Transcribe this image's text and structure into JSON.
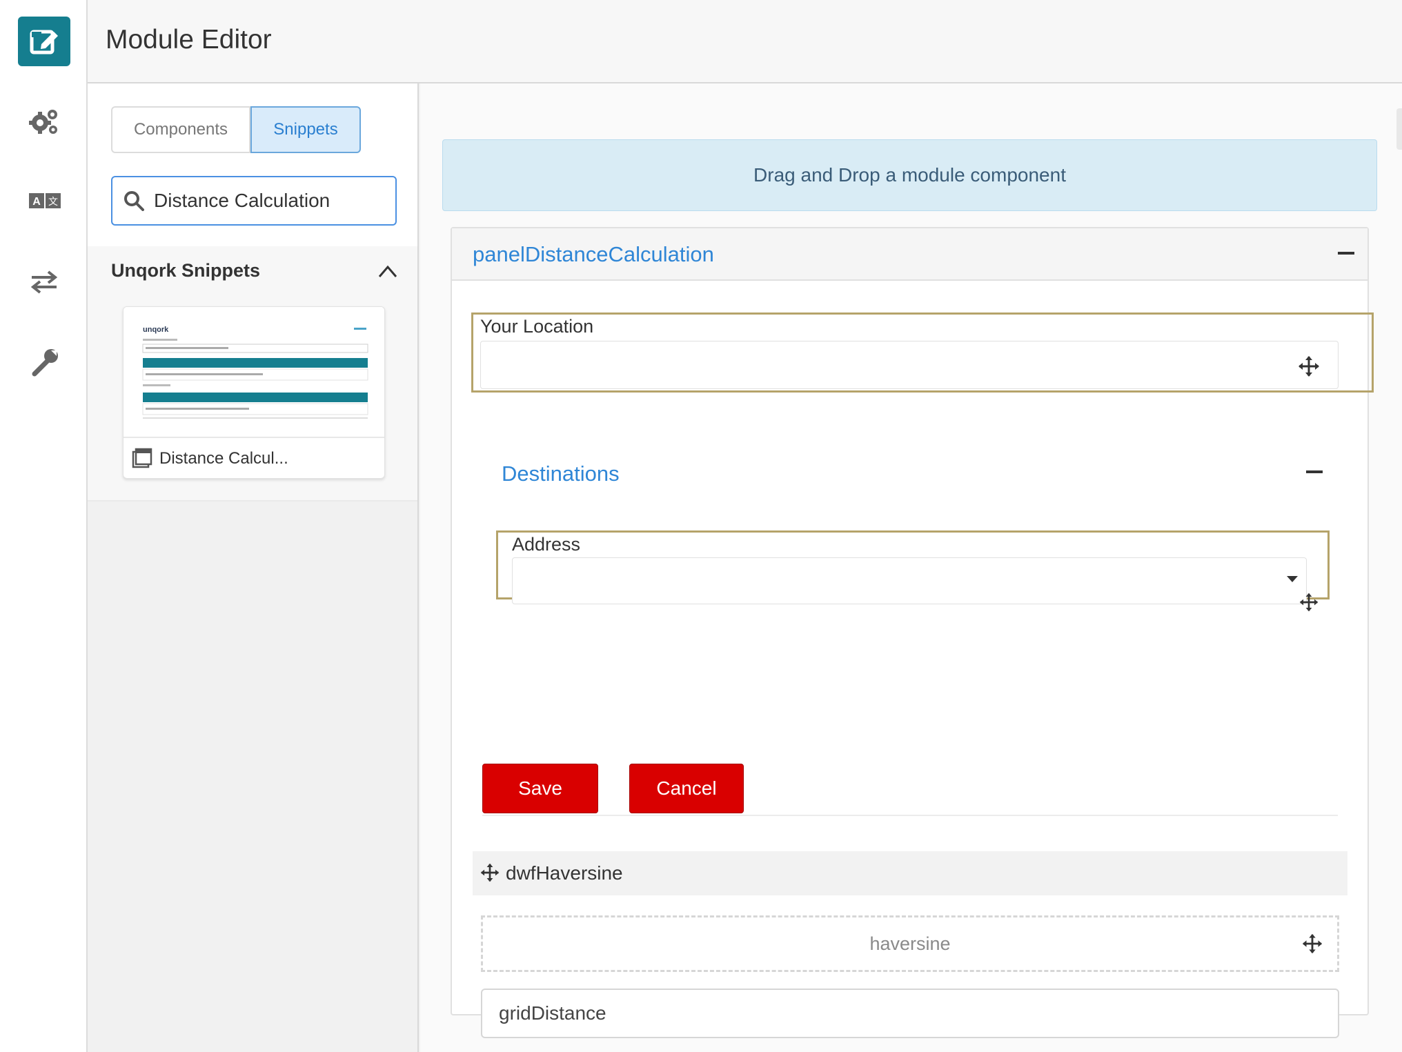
{
  "header": {
    "title": "Module Editor"
  },
  "rail": {
    "items": [
      {
        "name": "module-editor",
        "icon": "edit-icon",
        "active": true
      },
      {
        "name": "settings",
        "icon": "gears-icon"
      },
      {
        "name": "translation",
        "icon": "translate-icon"
      },
      {
        "name": "data-exchange",
        "icon": "arrows-exchange-icon"
      },
      {
        "name": "tools",
        "icon": "wrench-icon"
      }
    ],
    "accent": "#157e8f"
  },
  "leftpanel": {
    "tabs": [
      {
        "label": "Components",
        "active": false
      },
      {
        "label": "Snippets",
        "active": true
      }
    ],
    "search": {
      "value": "Distance Calculation",
      "icon": "search-icon"
    },
    "section": {
      "title": "Unqork Snippets",
      "icon": "chevron-up-icon"
    },
    "card": {
      "label": "Distance Calcul...",
      "icon": "window-icon",
      "thumb_brand": "unqork"
    }
  },
  "canvas": {
    "dropzone": "Drag and Drop a module component",
    "panel": {
      "title": "panelDistanceCalculation",
      "your_location": {
        "label": "Your Location",
        "value": ""
      },
      "destinations": {
        "title": "Destinations",
        "address": {
          "label": "Address",
          "value": ""
        }
      },
      "buttons": {
        "save": "Save",
        "cancel": "Cancel"
      },
      "dwf": {
        "label": "dwfHaversine"
      },
      "haversine": "haversine",
      "grid": "gridDistance"
    },
    "colors": {
      "link": "#2f86d6",
      "danger": "#d90000",
      "highlight": "#b5a36a"
    }
  }
}
